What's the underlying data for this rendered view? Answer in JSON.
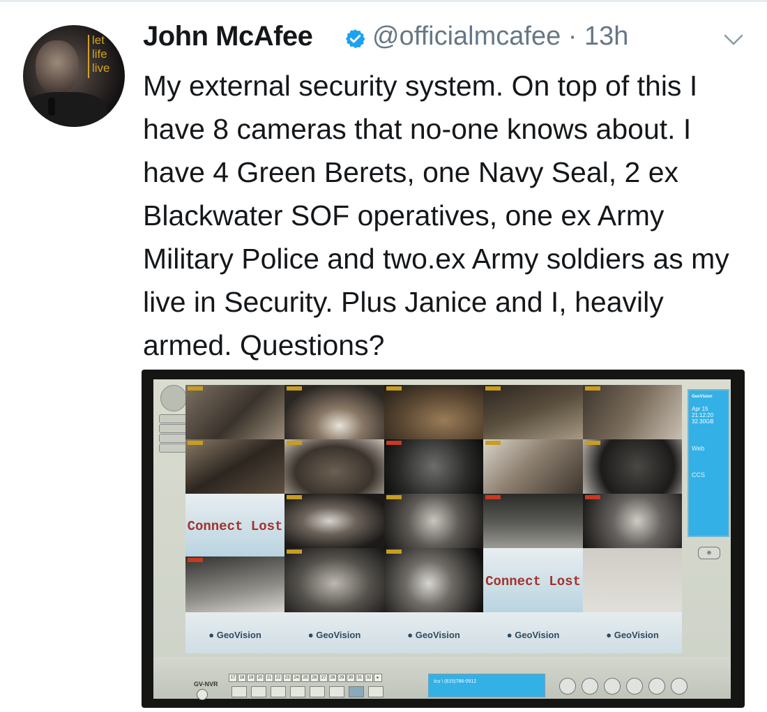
{
  "tweet": {
    "author_name": "John McAfee",
    "handle": "@officialmcafee",
    "separator": "·",
    "time_ago": "13h",
    "avatar_slogan": [
      "let",
      "life",
      "live"
    ],
    "text": "My external security system. On top of this I have 8 cameras that no-one knows about. I have 4 Green Berets, one Navy Seal, 2 ex Blackwater SOF operatives, one ex Army Military Police  and two.ex Army soldiers as my live in Security. Plus Janice and I, heavily armed. Questions?"
  },
  "icons": {
    "verified": "verified-badge-icon",
    "menu": "chevron-down-icon"
  },
  "colors": {
    "text": "#14171a",
    "secondary": "#657786",
    "verified_blue": "#1da1f2"
  },
  "monitor": {
    "panel_brand": "GeoVision",
    "date": "Apr 15",
    "time": "21:12:20",
    "storage": "32.30GB",
    "link_web": "Web",
    "link_ccs": "CCS",
    "connect_lost_label": "Connect Lost",
    "geo_logo": "GeoVision",
    "product": "GV-NVR",
    "phone_text": "Icu \\ (615)786-0912",
    "channel_numbers": [
      "17",
      "18",
      "19",
      "20",
      "21",
      "22",
      "23",
      "24",
      "25",
      "26",
      "27",
      "28",
      "29",
      "30",
      "31",
      "32"
    ]
  }
}
